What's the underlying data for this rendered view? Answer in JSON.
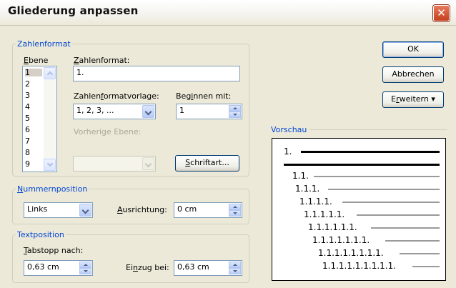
{
  "window": {
    "title": "Gliederung anpassen",
    "close_glyph": "✕",
    "close_icon": "close-icon"
  },
  "zahlenformat_group": {
    "legend": "Zahlenformat",
    "ebene_label_u": "E",
    "ebene_label_rest": "bene",
    "ebene_items": [
      "1",
      "2",
      "3",
      "4",
      "5",
      "6",
      "7",
      "8",
      "9"
    ],
    "zahlenformat_label_u": "Z",
    "zahlenformat_label_rest": "ahlenformat:",
    "zahlenformat_value": "1.",
    "vorlage_label_pre": "Zahlen",
    "vorlage_label_u": "f",
    "vorlage_label_rest": "ormatvorlage:",
    "vorlage_value": "1, 2, 3, ...",
    "beginnen_label_pre": "Beg",
    "beginnen_label_u": "i",
    "beginnen_label_rest": "nnen mit:",
    "beginnen_value": "1",
    "vorherige_label": "Vorherige Ebene:",
    "schriftart_u": "S",
    "schriftart_rest": "chriftart..."
  },
  "nummernposition_group": {
    "legend_u": "N",
    "legend_rest": "ummernposition",
    "position_value": "Links",
    "ausrichtung_label_u": "A",
    "ausrichtung_label_rest": "usrichtung:",
    "ausrichtung_value": "0 cm"
  },
  "textposition_group": {
    "legend": "Textposition",
    "tabstopp_label_u": "T",
    "tabstopp_label_rest": "abstopp nach:",
    "tabstopp_value": "0,63 cm",
    "einzug_label_pre": "Ei",
    "einzug_label_u": "n",
    "einzug_label_rest": "zug bei:",
    "einzug_value": "0,63 cm"
  },
  "buttons": {
    "ok": "OK",
    "abbrechen": "Abbrechen",
    "erweitern_pre": "E",
    "erweitern_u": "r",
    "erweitern_rest": "weitern",
    "erweitern_glyph": "▾"
  },
  "preview": {
    "label": "Vorschau",
    "lines": [
      "1.",
      "1.1.",
      "1.1.1.",
      "1.1.1.1.",
      "1.1.1.1.1.",
      "1.1.1.1.1.1.",
      "1.1.1.1.1.1.1.",
      "1.1.1.1.1.1.1.1.",
      "1.1.1.1.1.1.1.1.1."
    ]
  }
}
